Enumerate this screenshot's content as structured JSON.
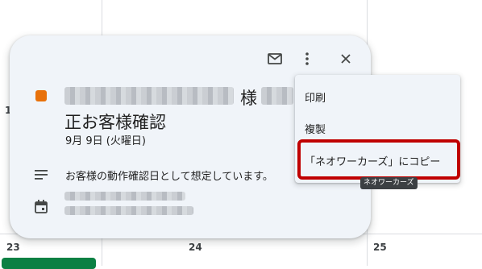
{
  "calendar": {
    "left_partial_day": "1",
    "days": [
      "23",
      "24",
      "25"
    ]
  },
  "popup": {
    "icons": [
      "mail-icon",
      "more-vert-icon",
      "close-icon"
    ],
    "event_color": "#e8710a",
    "title_suffix": "様",
    "title_line2": "正お客様確認",
    "date": "9月 9日 (火曜日)",
    "description": "お客様の動作確認日として想定しています。"
  },
  "menu": {
    "items": [
      {
        "label": "印刷"
      },
      {
        "label": "複製"
      },
      {
        "label": "「ネオワーカーズ」にコピー"
      }
    ]
  },
  "tooltip": {
    "text": "ネオワーカーズ"
  },
  "colors": {
    "highlight": "#c00000",
    "popup_bg": "#f0f4f9",
    "chip": "#0b8043"
  }
}
